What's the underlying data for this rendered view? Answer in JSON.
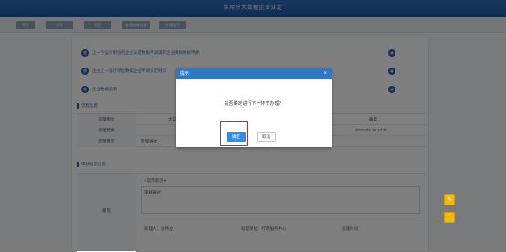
{
  "window": {
    "title": "实用分大数据企业认定"
  },
  "toolbar": {
    "buttons": [
      "保存",
      "打印",
      "退回",
      "查看附件信息",
      "办理意见"
    ]
  },
  "links": [
    {
      "label": "上一个设计单位的企业认定数据申请请求企业填报数据申请",
      "badge": "查"
    },
    {
      "label": "企业上一设计单位数据企业申请认定材料",
      "badge": "查"
    },
    {
      "label": "企业数据说明",
      "badge": "查"
    }
  ],
  "flow": {
    "section_title": "流程信息",
    "rows": [
      {
        "label": "受理单位",
        "value": "大口",
        "right": "备案"
      },
      {
        "label": "受理结果",
        "value": "",
        "right": "2023-03-18 17:11"
      },
      {
        "label": "受理意见",
        "value": "受理通过",
        "right": ""
      }
    ]
  },
  "opinion": {
    "section_title": "审核意见信息",
    "label": "意见",
    "select_value": "+常用意见 ▾",
    "text": "审核通过",
    "signer_label": "处理人：张伟立",
    "unit_label": "处理单位：行政服务中心",
    "date_label": "处理时间："
  },
  "dialog": {
    "title": "提示",
    "close": "×",
    "message": "是否确定进行下一环节办理？",
    "ok_label": "确定",
    "cancel_label": "取消"
  },
  "side_icons": [
    "✎",
    "⌃"
  ],
  "colors": {
    "title_bar": "#1e5aa8",
    "dialog_header": "#2f78c4",
    "ok_button": "#2f8de4",
    "highlight": "#e02020",
    "side_icon": "#f0b90b"
  }
}
